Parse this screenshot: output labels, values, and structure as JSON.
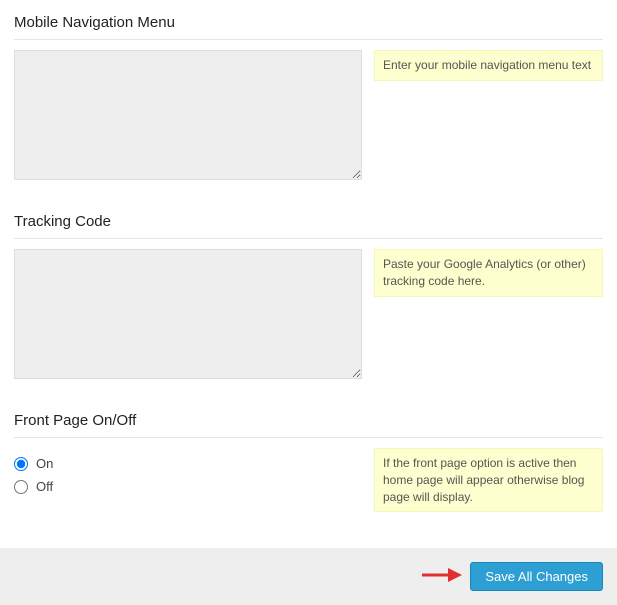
{
  "sections": {
    "mobile_nav": {
      "title": "Mobile Navigation Menu",
      "value": "",
      "hint": "Enter your mobile navigation menu text"
    },
    "tracking": {
      "title": "Tracking Code",
      "value": "",
      "hint": "Paste your Google Analytics (or other) tracking code here."
    },
    "frontpage": {
      "title": "Front Page On/Off",
      "options": {
        "on": "On",
        "off": "Off"
      },
      "selected": "on",
      "hint": "If the front page option is active then home page will appear otherwise blog page will display."
    }
  },
  "actions": {
    "save_label": "Save All Changes"
  }
}
